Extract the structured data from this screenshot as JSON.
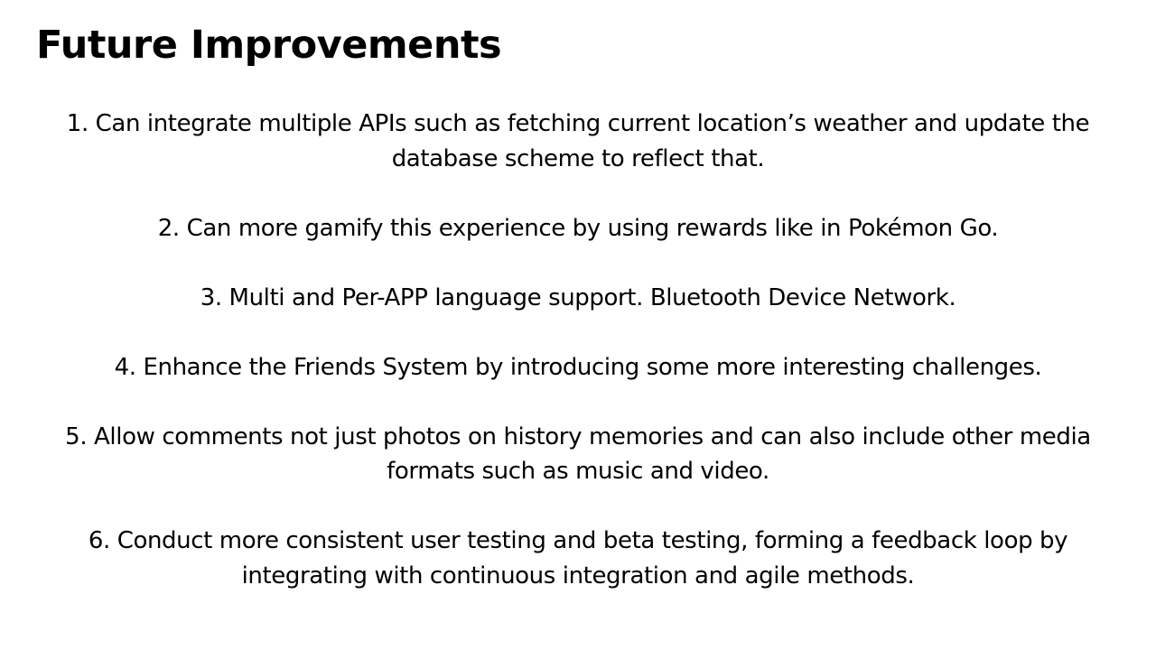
{
  "slide": {
    "title": "Future Improvements",
    "items": [
      "1. Can integrate multiple APIs such as fetching current location’s weather and update the database scheme to reflect that.",
      "2. Can more gamify this experience by using rewards like in Pokémon Go.",
      "3. Multi and Per-APP language support. Bluetooth Device Network.",
      "4. Enhance the Friends System by introducing some more interesting challenges.",
      "5. Allow comments not just photos on history memories and can also include other media formats such as music and video.",
      "6. Conduct more consistent user testing and beta testing, forming a feedback loop by integrating with continuous integration and agile methods."
    ]
  }
}
